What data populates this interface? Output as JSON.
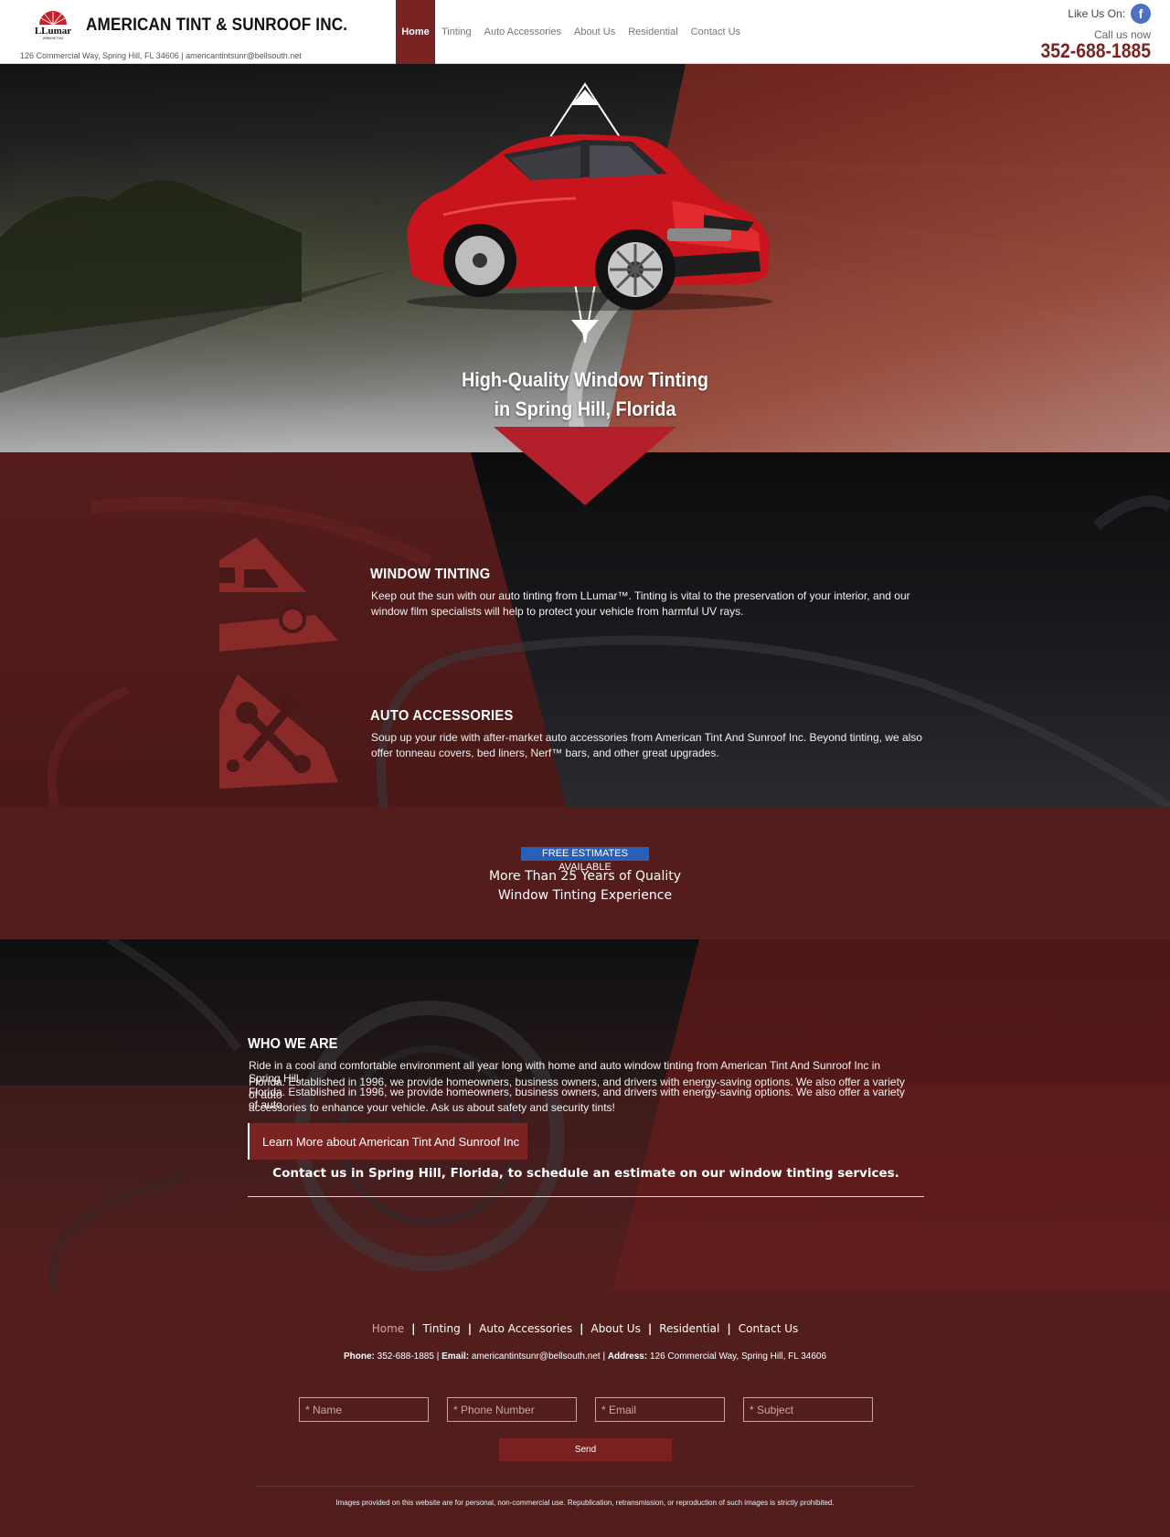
{
  "header": {
    "brand_title": "AMERICAN TINT & SUNROOF INC.",
    "logo_text": "LLumar",
    "logo_sub": "WINDOW FILM",
    "address_line": "126 Commercial Way, Spring Hill, FL 34606 | americantintsunr@bellsouth.net",
    "nav": [
      "Home",
      "Tinting",
      "Auto Accessories",
      "About Us",
      "Residential",
      "Contact Us"
    ],
    "active_nav": "Home",
    "like_label": "Like Us On:",
    "facebook_icon": "facebook-icon",
    "call_label": "Call us now",
    "phone": "352-688-1885"
  },
  "hero": {
    "headline_line1": "High-Quality Window Tinting",
    "headline_line2": "in Spring Hill, Florida"
  },
  "services": [
    {
      "title": "WINDOW TINTING",
      "text": "Keep out the sun with our auto tinting from LLumar™. Tinting is vital to the preservation of your interior, and our window film specialists will help to protect your vehicle from harmful UV rays.",
      "icon": "window-tint-icon"
    },
    {
      "title": "AUTO ACCESSORIES",
      "text": "Soup up your ride with after-market auto accessories from American Tint And Sunroof Inc. Beyond tinting, we also offer tonneau covers, bed liners, Nerf™ bars, and other great upgrades.",
      "icon": "tools-icon"
    }
  ],
  "estimates": {
    "badge": "FREE ESTIMATES AVAILABLE",
    "line1": "More Than 25 Years of Quality",
    "line2": "Window Tinting Experience"
  },
  "who": {
    "title": "WHO WE ARE",
    "text_line1": "Ride in a cool and comfortable environment all year long with home and auto window tinting from American Tint And Sunroof Inc in Spring Hill,",
    "text_line2": "Florida. Established in 1996, we provide homeowners, business owners, and drivers with energy-saving options. We also offer a variety of auto",
    "text_line3": "Florida. Established in 1996, we provide homeowners, business owners, and drivers with energy-saving options. We also offer a variety of auto",
    "text_line4": "accessories to enhance your vehicle. Ask us about safety and security tints!",
    "button": "Learn More about American Tint And Sunroof Inc",
    "cta": "Contact us in Spring Hill, Florida, to schedule an estimate on our window tinting services."
  },
  "footer": {
    "nav": [
      "Home",
      "Tinting",
      "Auto Accessories",
      "About Us",
      "Residential",
      "Contact Us"
    ],
    "phone_label": "Phone:",
    "phone": "352-688-1885",
    "email_label": "Email:",
    "email": "americantintsunr@bellsouth.net",
    "address_label": "Address:",
    "address": "126 Commercial Way, Spring Hill, FL 34606",
    "form": {
      "name_placeholder": "* Name",
      "phone_placeholder": "* Phone Number",
      "email_placeholder": "* Email",
      "subject_placeholder": "* Subject",
      "send_label": "Send"
    },
    "disclaimer": "Images provided on this website are for personal, non-commercial use. Republication, retransmission, or reproduction of such images is strictly prohibited."
  },
  "colors": {
    "brand_red": "#7a2323",
    "accent_blue": "#2a5fb8",
    "facebook_blue": "#4d6fc6",
    "arrow_red": "#b3202b"
  }
}
